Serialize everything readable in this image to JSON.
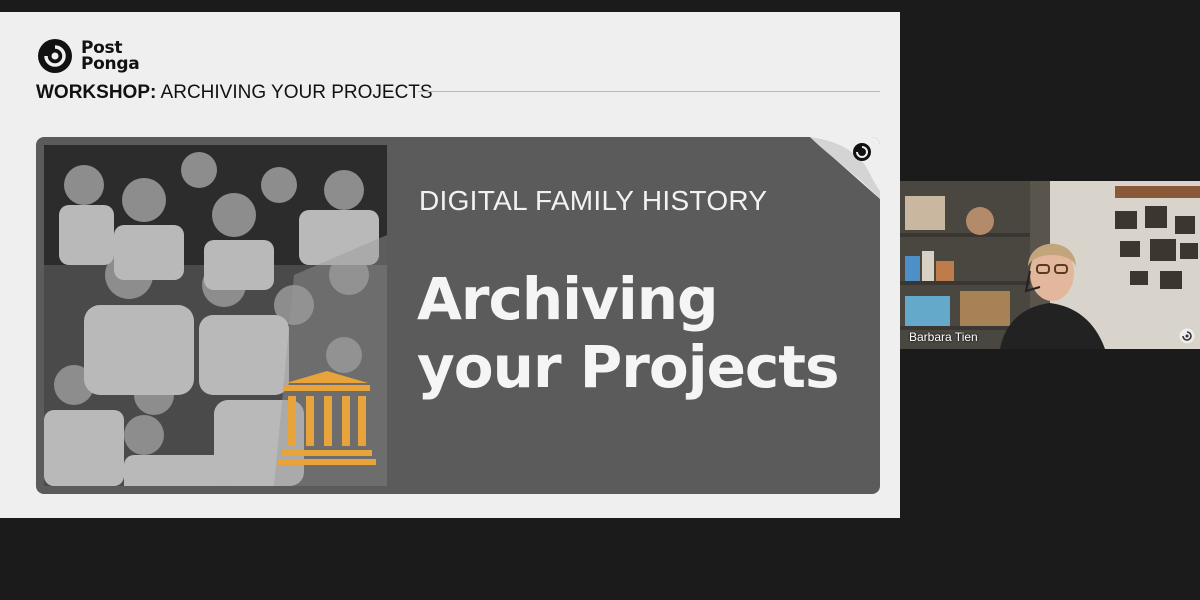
{
  "slide": {
    "logo_line1": "Post",
    "logo_line2": "Ponga",
    "workshop_prefix": "WORKSHOP:",
    "workshop_title": " ARCHIVING YOUR PROJECTS",
    "kicker": "DIGITAL FAMILY HISTORY",
    "title": "Archiving your Projects"
  },
  "participant": {
    "name": "Barbara Tien"
  },
  "colors": {
    "accent": "#e8a33a",
    "card": "#5b5b5b",
    "slide_bg": "#efefef"
  }
}
